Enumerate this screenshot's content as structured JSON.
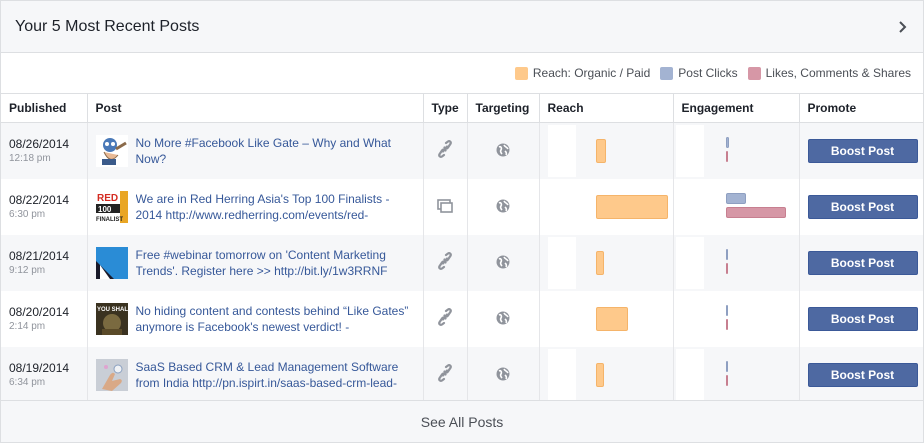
{
  "header": {
    "title": "Your 5 Most Recent Posts"
  },
  "legend": [
    {
      "label": "Reach: Organic / Paid",
      "color": "#fec98b"
    },
    {
      "label": "Post Clicks",
      "color": "#a3b3d2"
    },
    {
      "label": "Likes, Comments & Shares",
      "color": "#d697a6"
    }
  ],
  "columns": {
    "published": "Published",
    "post": "Post",
    "type": "Type",
    "targeting": "Targeting",
    "reach": "Reach",
    "engagement": "Engagement",
    "promote": "Promote"
  },
  "rows": [
    {
      "date": "08/26/2014",
      "time": "12:18 pm",
      "text": "No More #Facebook Like Gate – Why and What Now?",
      "thumb_icon": "cartoon-thumbnail",
      "type_icon": "link-icon",
      "reach_level": 0.1,
      "clicks_level": 0.05,
      "likes_level": 0.02,
      "boost": "Boost Post"
    },
    {
      "date": "08/22/2014",
      "time": "6:30 pm",
      "text": "We are in Red Herring Asia's Top 100 Finalists - 2014 http://www.redherring.com/events/red-",
      "thumb_icon": "red-herring-thumbnail",
      "type_icon": "album-icon",
      "reach_level": 0.75,
      "clicks_level": 0.33,
      "likes_level": 1.0,
      "boost": "Boost Post"
    },
    {
      "date": "08/21/2014",
      "time": "9:12 pm",
      "text": "Free #webinar tomorrow on 'Content Marketing Trends'. Register here >> http://bit.ly/1w3RRNF",
      "thumb_icon": "webinar-thumbnail",
      "type_icon": "link-icon",
      "reach_level": 0.06,
      "clicks_level": 0.02,
      "likes_level": 0.02,
      "boost": "Boost Post"
    },
    {
      "date": "08/20/2014",
      "time": "2:14 pm",
      "text": "No hiding content and contests behind “Like Gates” anymore is Facebook's newest verdict! -",
      "thumb_icon": "you-shall-thumbnail",
      "type_icon": "link-icon",
      "reach_level": 0.33,
      "clicks_level": 0.03,
      "likes_level": 0.02,
      "boost": "Boost Post"
    },
    {
      "date": "08/19/2014",
      "time": "6:34 pm",
      "text": "SaaS Based CRM & Lead Management Software from India http://pn.ispirt.in/saas-based-crm-lead-",
      "thumb_icon": "hand-touch-thumbnail",
      "type_icon": "link-icon",
      "reach_level": 0.05,
      "clicks_level": 0.02,
      "likes_level": 0.02,
      "boost": "Boost Post"
    }
  ],
  "footer": {
    "label": "See All Posts"
  }
}
